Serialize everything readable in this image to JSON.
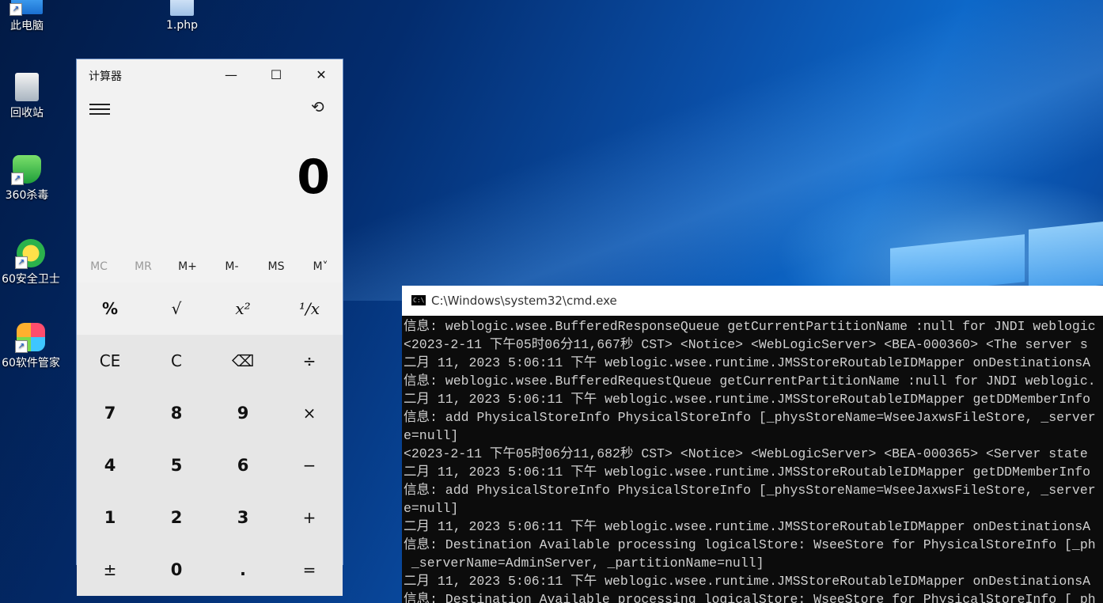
{
  "desktop": {
    "icons": [
      {
        "id": "pc",
        "label": "此电脑"
      },
      {
        "id": "php",
        "label": "1.php"
      },
      {
        "id": "recycle",
        "label": "回收站"
      },
      {
        "id": "av",
        "label": "360杀毒"
      },
      {
        "id": "safe",
        "label": "60安全卫士"
      },
      {
        "id": "soft",
        "label": "60软件管家"
      }
    ]
  },
  "calculator": {
    "title": "计算器",
    "display": "0",
    "memory": [
      "MC",
      "MR",
      "M+",
      "M-",
      "MS",
      "M˅"
    ],
    "keys": {
      "percent": "%",
      "sqrt": "√",
      "square": "x²",
      "reciprocal": "¹/x",
      "ce": "CE",
      "c": "C",
      "backspace": "⌫",
      "divide": "÷",
      "seven": "7",
      "eight": "8",
      "nine": "9",
      "multiply": "×",
      "four": "4",
      "five": "5",
      "six": "6",
      "minus": "−",
      "one": "1",
      "two": "2",
      "three": "3",
      "plus": "+",
      "negate": "±",
      "zero": "0",
      "decimal": ".",
      "equals": "="
    }
  },
  "cmd": {
    "title": "C:\\Windows\\system32\\cmd.exe",
    "lines": [
      "信息: weblogic.wsee.BufferedResponseQueue getCurrentPartitionName :null for JNDI weblogic",
      "<2023-2-11 下午05时06分11,667秒 CST> <Notice> <WebLogicServer> <BEA-000360> <The server s",
      "二月 11, 2023 5:06:11 下午 weblogic.wsee.runtime.JMSStoreRoutableIDMapper onDestinationsA",
      "信息: weblogic.wsee.BufferedRequestQueue getCurrentPartitionName :null for JNDI weblogic.",
      "二月 11, 2023 5:06:11 下午 weblogic.wsee.runtime.JMSStoreRoutableIDMapper getDDMemberInfo",
      "信息: add PhysicalStoreInfo PhysicalStoreInfo [_physStoreName=WseeJaxwsFileStore, _server",
      "e=null]",
      "<2023-2-11 下午05时06分11,682秒 CST> <Notice> <WebLogicServer> <BEA-000365> <Server state",
      "二月 11, 2023 5:06:11 下午 weblogic.wsee.runtime.JMSStoreRoutableIDMapper getDDMemberInfo",
      "信息: add PhysicalStoreInfo PhysicalStoreInfo [_physStoreName=WseeJaxwsFileStore, _server",
      "e=null]",
      "二月 11, 2023 5:06:11 下午 weblogic.wsee.runtime.JMSStoreRoutableIDMapper onDestinationsA",
      "信息: Destination Available processing logicalStore: WseeStore for PhysicalStoreInfo [_ph",
      " _serverName=AdminServer, _partitionName=null]",
      "二月 11, 2023 5:06:11 下午 weblogic.wsee.runtime.JMSStoreRoutableIDMapper onDestinationsA",
      "信息: Destination Available processing logicalStore: WseeStore for PhysicalStoreInfo [_ph"
    ]
  }
}
